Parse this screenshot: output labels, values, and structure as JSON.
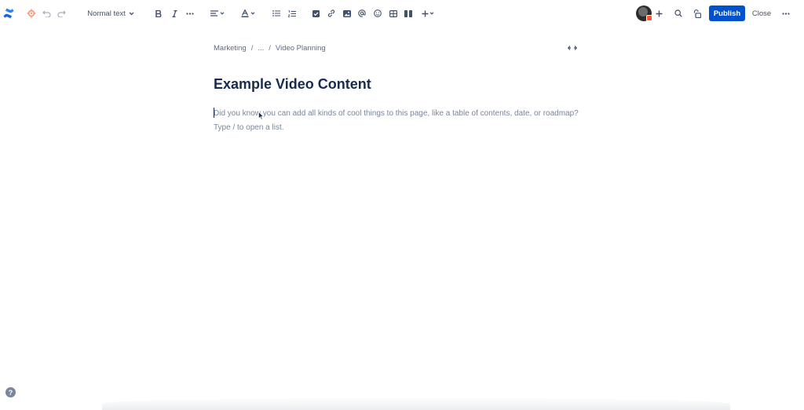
{
  "toolbar": {
    "text_style": "Normal text",
    "publish_label": "Publish",
    "close_label": "Close",
    "icons": [
      "confluence-logo-icon",
      "settings-icon",
      "undo-icon",
      "redo-icon",
      "chevron-down-icon",
      "bold-icon",
      "italic-icon",
      "more-formatting-icon",
      "align-icon",
      "text-color-icon",
      "bullet-list-icon",
      "numbered-list-icon",
      "task-icon",
      "link-icon",
      "image-icon",
      "mention-icon",
      "emoji-icon",
      "table-icon",
      "layouts-icon",
      "insert-icon",
      "invite-icon",
      "search-icon",
      "restrictions-icon",
      "more-actions-icon"
    ]
  },
  "breadcrumb": {
    "items": [
      "Marketing",
      "...",
      "Video Planning"
    ],
    "separator": "/"
  },
  "page": {
    "title": "Example Video Content",
    "placeholder_line1": "Did you know you can add all kinds of cool things to this page, like a table of contents, date, or roadmap?",
    "placeholder_line2": "Type / to open a list."
  },
  "help_label": "?",
  "colors": {
    "primary": "#0052cc",
    "text": "#172b4d",
    "subtle_text": "#42526e",
    "placeholder": "#7a869a",
    "settings_accent": "#ff8f73"
  }
}
